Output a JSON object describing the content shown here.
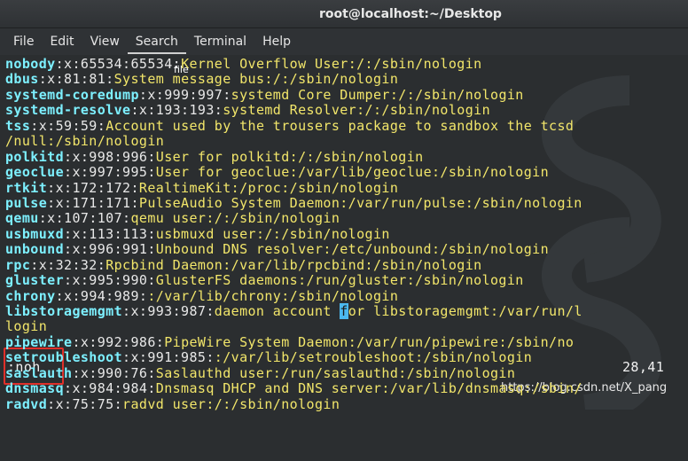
{
  "window": {
    "title": "root@localhost:~/Desktop"
  },
  "menu": {
    "items": [
      "File",
      "Edit",
      "View",
      "Search",
      "Terminal",
      "Help"
    ],
    "active": "Search"
  },
  "tooltip": "file",
  "lines": [
    {
      "user": "nobody",
      "fields": ":x:65534:65534:",
      "desc": "Kernel Overflow User",
      "path": ":/:/sbin/nologin"
    },
    {
      "user": "dbus",
      "fields": ":x:81:81:",
      "desc": "System message bus",
      "path": ":/:/sbin/nologin"
    },
    {
      "user": "systemd-coredump",
      "fields": ":x:999:997:",
      "desc": "systemd Core Dumper",
      "path": ":/:/sbin/nologin"
    },
    {
      "user": "systemd-resolve",
      "fields": ":x:193:193:",
      "desc": "systemd Resolver",
      "path": ":/:/sbin/nologin"
    },
    {
      "user": "tss",
      "fields": ":x:59:59:",
      "desc": "Account used by the trousers package to sandbox the tcsd",
      "path": ""
    },
    {
      "user": "",
      "fields": "",
      "desc": "",
      "path": "/null:/sbin/nologin"
    },
    {
      "user": "polkitd",
      "fields": ":x:998:996:",
      "desc": "User for polkitd",
      "path": ":/:/sbin/nologin"
    },
    {
      "user": "geoclue",
      "fields": ":x:997:995:",
      "desc": "User for geoclue",
      "path": ":/var/lib/geoclue:/sbin/nologin"
    },
    {
      "user": "rtkit",
      "fields": ":x:172:172:",
      "desc": "RealtimeKit",
      "path": ":/proc:/sbin/nologin"
    },
    {
      "user": "pulse",
      "fields": ":x:171:171:",
      "desc": "PulseAudio System Daemon",
      "path": ":/var/run/pulse:/sbin/nologin"
    },
    {
      "user": "qemu",
      "fields": ":x:107:107:",
      "desc": "qemu user",
      "path": ":/:/sbin/nologin"
    },
    {
      "user": "usbmuxd",
      "fields": ":x:113:113:",
      "desc": "usbmuxd user",
      "path": ":/:/sbin/nologin"
    },
    {
      "user": "unbound",
      "fields": ":x:996:991:",
      "desc": "Unbound DNS resolver",
      "path": ":/etc/unbound:/sbin/nologin"
    },
    {
      "user": "rpc",
      "fields": ":x:32:32:",
      "desc": "Rpcbind Daemon",
      "path": ":/var/lib/rpcbind:/sbin/nologin"
    },
    {
      "user": "gluster",
      "fields": ":x:995:990:",
      "desc": "GlusterFS daemons",
      "path": ":/run/gluster:/sbin/nologin"
    },
    {
      "user": "chrony",
      "fields": ":x:994:989:",
      "desc": "",
      "path": ":/var/lib/chrony:/sbin/nologin"
    },
    {
      "user": "libstoragemgmt",
      "fields": ":x:993:987:",
      "desc": "daemon account ",
      "cursor": "f",
      "desc2": "or libstoragemgmt",
      "path": ":/var/run/l"
    },
    {
      "user": "",
      "fields": "",
      "desc": "",
      "path": "login"
    },
    {
      "user": "pipewire",
      "fields": ":x:992:986:",
      "desc": "PipeWire System Daemon",
      "path": ":/var/run/pipewire:/sbin/no"
    },
    {
      "user": "setroubleshoot",
      "fields": ":x:991:985:",
      "desc": "",
      "path": ":/var/lib/setroubleshoot:/sbin/nologin"
    },
    {
      "user": "saslauth",
      "fields": ":x:990:76:",
      "desc": "Saslauthd user",
      "path": ":/run/saslauthd:/sbin/nologin"
    },
    {
      "user": "dnsmasq",
      "fields": ":x:984:984:",
      "desc": "Dnsmasq DHCP and DNS server",
      "path": ":/var/lib/dnsmasq:/sbin/"
    },
    {
      "user": "radvd",
      "fields": ":x:75:75:",
      "desc": "radvd user",
      "path": ":/:/sbin/nologin"
    }
  ],
  "command": ":noh",
  "cursor_position": "28,41",
  "watermark": "https://blog.csdn.net/X_pang"
}
